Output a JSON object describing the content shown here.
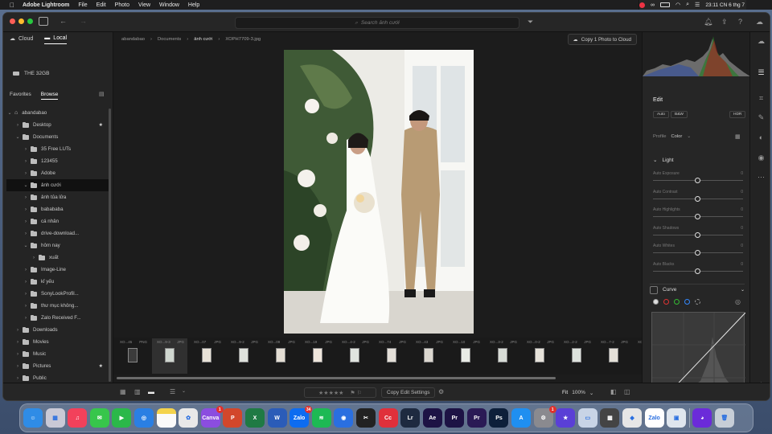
{
  "menubar": {
    "apple": "",
    "items": [
      "Adobe Lightroom",
      "File",
      "Edit",
      "Photo",
      "View",
      "Window",
      "Help"
    ],
    "clock": "23:11 CN 6 thg 7"
  },
  "titlebar": {
    "search_placeholder": "Search ảnh cưới"
  },
  "left": {
    "tabs": [
      {
        "label": "Cloud",
        "active": false
      },
      {
        "label": "Local",
        "active": true
      }
    ],
    "drive": "THE 32GB",
    "subtabs": [
      "Favorites",
      "Browse"
    ],
    "tree": [
      {
        "label": "abandabao",
        "level": 0,
        "open": true,
        "home": true
      },
      {
        "label": "Desktop",
        "level": 1,
        "open": false,
        "star": true
      },
      {
        "label": "Documents",
        "level": 1,
        "open": true
      },
      {
        "label": "35 Free LUTs",
        "level": 2
      },
      {
        "label": "123455",
        "level": 2
      },
      {
        "label": "Adobe",
        "level": 2
      },
      {
        "label": "ảnh cưới",
        "level": 2,
        "open": true,
        "selected": true
      },
      {
        "label": "ảnh tủa lửa",
        "level": 2
      },
      {
        "label": "babababa",
        "level": 2
      },
      {
        "label": "cá nhân",
        "level": 2
      },
      {
        "label": "drive-download...",
        "level": 2
      },
      {
        "label": "hôm nay",
        "level": 2,
        "open": true
      },
      {
        "label": "xuất",
        "level": 3
      },
      {
        "label": "Image-Line",
        "level": 2
      },
      {
        "label": "kỉ yếu",
        "level": 2
      },
      {
        "label": "SonyLookProfil...",
        "level": 2
      },
      {
        "label": "thư mục không...",
        "level": 2
      },
      {
        "label": "Zalo Received F...",
        "level": 2
      },
      {
        "label": "Downloads",
        "level": 1
      },
      {
        "label": "Movies",
        "level": 1
      },
      {
        "label": "Music",
        "level": 1
      },
      {
        "label": "Pictures",
        "level": 1,
        "star": true
      },
      {
        "label": "Public",
        "level": 1
      }
    ]
  },
  "center": {
    "breadcrumb": [
      "abandabao",
      "Documents",
      "ảnh cưới",
      "XOPH7709-3.jpg"
    ],
    "copy_to_cloud": "Copy 1 Photo to Cloud",
    "filmstrip": [
      {
        "name": "XO...45",
        "type": "PNG"
      },
      {
        "name": "XO...9-3",
        "type": "JPG",
        "selected": true
      },
      {
        "name": "XO...07",
        "type": "JPG"
      },
      {
        "name": "XO...9-2",
        "type": "JPG"
      },
      {
        "name": "XO...09",
        "type": "JPG"
      },
      {
        "name": "XO...19",
        "type": "JPG"
      },
      {
        "name": "XO...4-2",
        "type": "JPG"
      },
      {
        "name": "XO...74",
        "type": "JPG"
      },
      {
        "name": "XO...43",
        "type": "JPG"
      },
      {
        "name": "XO...10",
        "type": "JPG"
      },
      {
        "name": "XO...3-2",
        "type": "JPG"
      },
      {
        "name": "XO...0-2",
        "type": "JPG"
      },
      {
        "name": "XO...2-2",
        "type": "JPG"
      },
      {
        "name": "XO...7-2",
        "type": "JPG"
      },
      {
        "name": "XO",
        "type": ""
      }
    ]
  },
  "bottom": {
    "stars": "★★★★★",
    "copy_edit": "Copy Edit Settings",
    "fit": "Fit",
    "zoom": "100%"
  },
  "right": {
    "edit": "Edit",
    "buttons": [
      "Auto",
      "B&W",
      "HDR"
    ],
    "profile_label": "Profile",
    "profile_value": "Color",
    "light": "Light",
    "sliders": [
      {
        "name": "Auto Exposure",
        "value": "0"
      },
      {
        "name": "Auto Contrast",
        "value": "0"
      },
      {
        "name": "Auto Highlights",
        "value": "0"
      },
      {
        "name": "Auto Shadows",
        "value": "0"
      },
      {
        "name": "Auto Whites",
        "value": "0"
      },
      {
        "name": "Auto Blacks",
        "value": "0"
      }
    ],
    "curve": "Curve"
  },
  "dock": [
    {
      "name": "finder",
      "label": "☺",
      "color": "#2f8ce6"
    },
    {
      "name": "launchpad",
      "label": "▦",
      "color": "#c9c9d6"
    },
    {
      "name": "music",
      "label": "♫",
      "color": "#f2415b"
    },
    {
      "name": "messages",
      "label": "✉",
      "color": "#37c64b"
    },
    {
      "name": "facetime",
      "label": "▶",
      "color": "#2bb84a"
    },
    {
      "name": "safari",
      "label": "◎",
      "color": "#2a7fe3"
    },
    {
      "name": "notes",
      "label": "",
      "color": "#f4d34c"
    },
    {
      "name": "photos",
      "label": "✿",
      "color": "#e8e8e8"
    },
    {
      "name": "canva",
      "label": "Canva",
      "color": "#8b4de0",
      "badge": "1"
    },
    {
      "name": "powerpoint",
      "label": "P",
      "color": "#d2472b"
    },
    {
      "name": "excel",
      "label": "X",
      "color": "#1f7a44"
    },
    {
      "name": "word",
      "label": "W",
      "color": "#2b5cb8"
    },
    {
      "name": "zalo",
      "label": "Zalo",
      "color": "#0d6cf0",
      "badge": "34"
    },
    {
      "name": "spotify",
      "label": "≋",
      "color": "#1db954"
    },
    {
      "name": "podcast",
      "label": "◉",
      "color": "#2a6fe0"
    },
    {
      "name": "capcut",
      "label": "✂",
      "color": "#222222"
    },
    {
      "name": "creative-cloud",
      "label": "Cc",
      "color": "#e0303b"
    },
    {
      "name": "lightroom",
      "label": "Lr",
      "color": "#1e2a40"
    },
    {
      "name": "after-effects",
      "label": "Ae",
      "color": "#1d1345"
    },
    {
      "name": "premiere",
      "label": "Pr",
      "color": "#1d1345"
    },
    {
      "name": "premiere-2",
      "label": "Pr",
      "color": "#2a1a55"
    },
    {
      "name": "photoshop",
      "label": "Ps",
      "color": "#0d1f3a"
    },
    {
      "name": "app-store",
      "label": "A",
      "color": "#1f8ff0"
    },
    {
      "name": "settings",
      "label": "⚙",
      "color": "#8a8a8f",
      "badge": "1"
    },
    {
      "name": "imovie",
      "label": "★",
      "color": "#5a3fd6"
    },
    {
      "name": "preview",
      "label": "▭",
      "color": "#c8d4e6"
    },
    {
      "name": "calculator",
      "label": "▦",
      "color": "#444444"
    },
    {
      "name": "roblox",
      "label": "◆",
      "color": "#e6e6e6"
    },
    {
      "name": "zalo-2",
      "label": "Zalo",
      "color": "#ffffff"
    },
    {
      "name": "screen",
      "label": "▣",
      "color": "#dfe6ee"
    },
    {
      "name": "tweaks",
      "label": "◕",
      "color": "#6b2bd9"
    },
    {
      "name": "trash",
      "label": "🗑",
      "color": "#c7ced7"
    }
  ]
}
